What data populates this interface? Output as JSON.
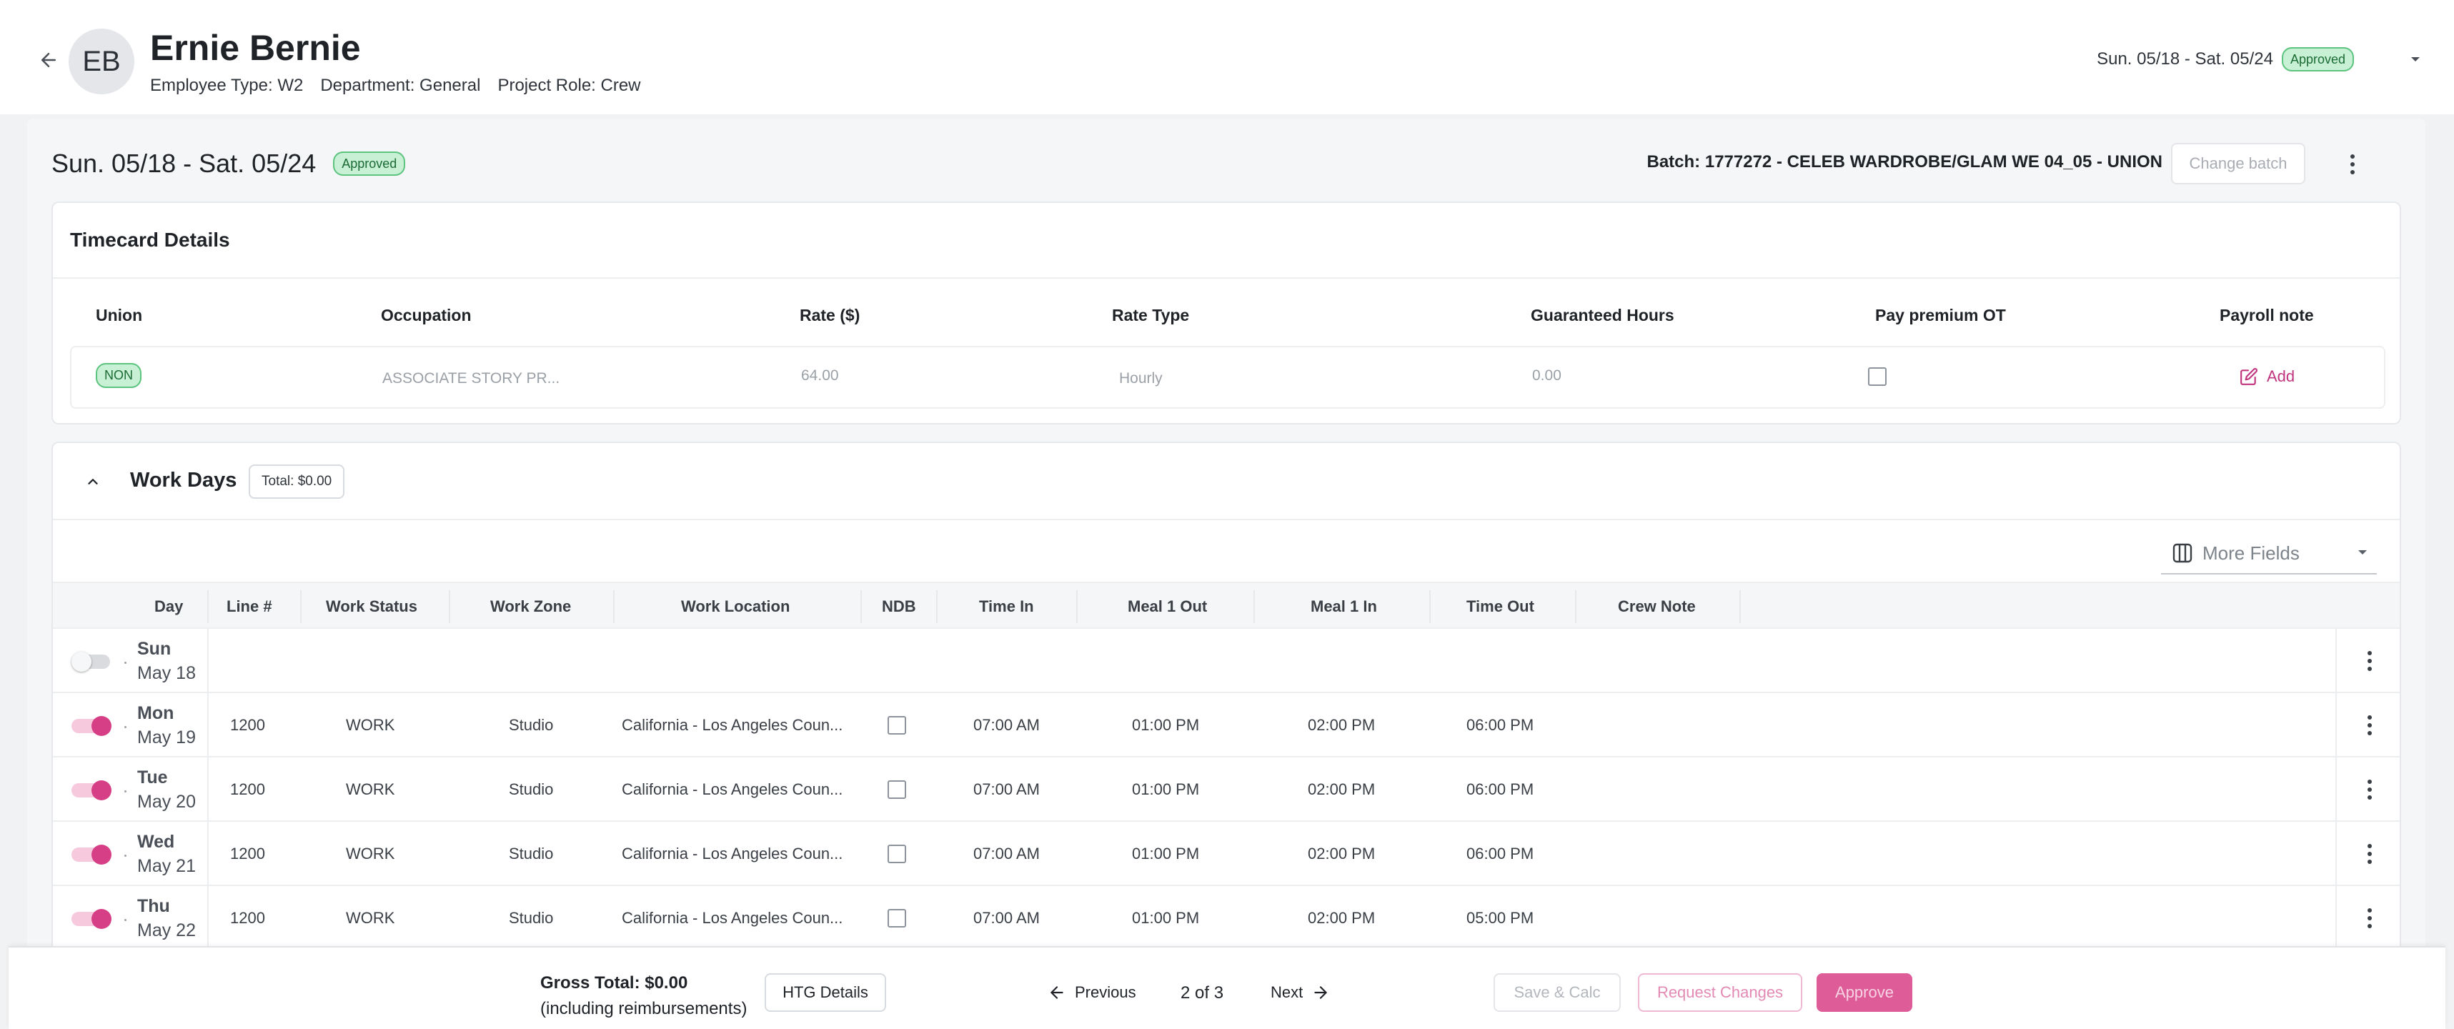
{
  "employee": {
    "initials": "EB",
    "name": "Ernie Bernie",
    "employee_type": "Employee Type: W2",
    "department": "Department: General",
    "project_role": "Project Role: Crew"
  },
  "top_selector": {
    "week": "Sun. 05/18 - Sat. 05/24",
    "status": "Approved"
  },
  "timecard": {
    "week": "Sun. 05/18 - Sat. 05/24",
    "status": "Approved",
    "batch": "Batch: 1777272 - CELEB WARDROBE/GLAM WE 04_05 - UNION",
    "change_batch_label": "Change batch"
  },
  "details": {
    "title": "Timecard Details",
    "headers": {
      "union": "Union",
      "occupation": "Occupation",
      "rate": "Rate ($)",
      "rate_type": "Rate Type",
      "guaranteed_hours": "Guaranteed Hours",
      "pay_premium_ot": "Pay premium OT",
      "payroll_note": "Payroll note"
    },
    "row": {
      "union": "NON",
      "occupation": "ASSOCIATE STORY PR...",
      "rate": "64.00",
      "rate_type": "Hourly",
      "guaranteed_hours": "0.00",
      "pay_premium_ot": false,
      "payroll_note_action": "Add"
    }
  },
  "work_days": {
    "title": "Work Days",
    "total": "Total: $0.00",
    "more_fields": "More Fields",
    "columns": {
      "day": "Day",
      "line": "Line #",
      "status": "Work Status",
      "zone": "Work Zone",
      "location": "Work Location",
      "ndb": "NDB",
      "time_in": "Time In",
      "meal1_out": "Meal 1 Out",
      "meal1_in": "Meal 1 In",
      "time_out": "Time Out",
      "crew_note": "Crew Note"
    },
    "rows": [
      {
        "day": "Sun",
        "date": "May 18",
        "enabled": false
      },
      {
        "day": "Mon",
        "date": "May 19",
        "enabled": true,
        "line": "1200",
        "status": "WORK",
        "zone": "Studio",
        "location": "California - Los Angeles Coun...",
        "ndb": false,
        "time_in": "07:00 AM",
        "meal1_out": "01:00 PM",
        "meal1_in": "02:00 PM",
        "time_out": "06:00 PM"
      },
      {
        "day": "Tue",
        "date": "May 20",
        "enabled": true,
        "line": "1200",
        "status": "WORK",
        "zone": "Studio",
        "location": "California - Los Angeles Coun...",
        "ndb": false,
        "time_in": "07:00 AM",
        "meal1_out": "01:00 PM",
        "meal1_in": "02:00 PM",
        "time_out": "06:00 PM"
      },
      {
        "day": "Wed",
        "date": "May 21",
        "enabled": true,
        "line": "1200",
        "status": "WORK",
        "zone": "Studio",
        "location": "California - Los Angeles Coun...",
        "ndb": false,
        "time_in": "07:00 AM",
        "meal1_out": "01:00 PM",
        "meal1_in": "02:00 PM",
        "time_out": "06:00 PM"
      },
      {
        "day": "Thu",
        "date": "May 22",
        "enabled": true,
        "line": "1200",
        "status": "WORK",
        "zone": "Studio",
        "location": "California - Los Angeles Coun...",
        "ndb": false,
        "time_in": "07:00 AM",
        "meal1_out": "01:00 PM",
        "meal1_in": "02:00 PM",
        "time_out": "05:00 PM"
      }
    ]
  },
  "footer": {
    "gross_total": "Gross Total: $0.00",
    "gross_note": "(including reimbursements)",
    "htg_label": "HTG Details",
    "previous_label": "Previous",
    "page_indicator": "2 of 3",
    "next_label": "Next",
    "save_label": "Save & Calc",
    "request_label": "Request Changes",
    "approve_label": "Approve"
  },
  "colors": {
    "accent": "#d63f86",
    "approved_bg": "#c8f0d4",
    "approved_text": "#1b6b34"
  },
  "icons": {
    "back": "arrow-left-icon",
    "caret": "chevron-down-icon",
    "kebab": "more-vertical-icon",
    "note": "edit-note-icon",
    "columns": "columns-icon",
    "collapse": "chevron-up-icon"
  }
}
